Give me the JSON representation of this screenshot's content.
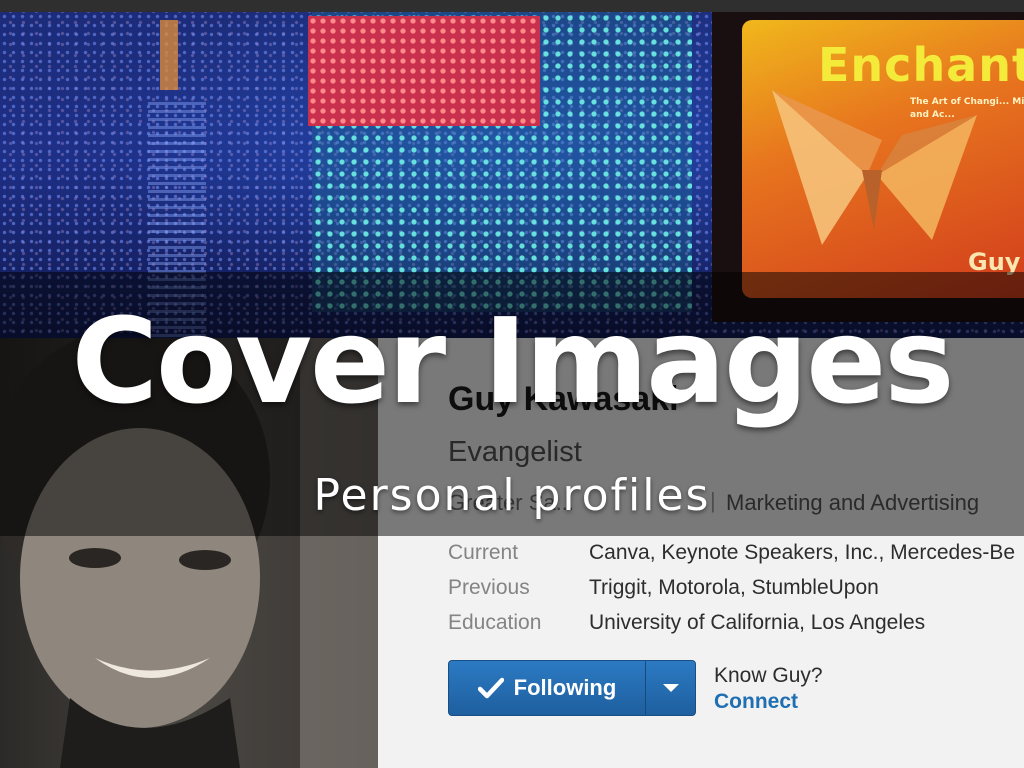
{
  "slide": {
    "title": "Cover Images",
    "subtitle": "Personal profiles"
  },
  "cover_photo": {
    "book": {
      "title": "Enchant",
      "subtitle": "The Art of Changi... Minds, and Ac...",
      "author": "Guy"
    }
  },
  "profile": {
    "name": "Guy Kawasaki",
    "headline": "Evangelist",
    "location": "Greater Sa...",
    "industry_separator": "|",
    "industry": "Marketing and Advertising",
    "details": [
      {
        "label": "Current",
        "value": "Canva, Keynote Speakers, Inc., Mercedes-Be"
      },
      {
        "label": "Previous",
        "value": "Triggit, Motorola, StumbleUpon"
      },
      {
        "label": "Education",
        "value": "University of California, Los Angeles"
      }
    ],
    "follow_button": {
      "label": "Following",
      "check_icon": "check-icon",
      "dropdown_icon": "caret-down-icon"
    },
    "know_prompt": "Know Guy?",
    "connect_link": "Connect"
  },
  "colors": {
    "follow_button": "#2c7ac3",
    "connect_link": "#1f6fb2",
    "overlay": "#000000"
  }
}
